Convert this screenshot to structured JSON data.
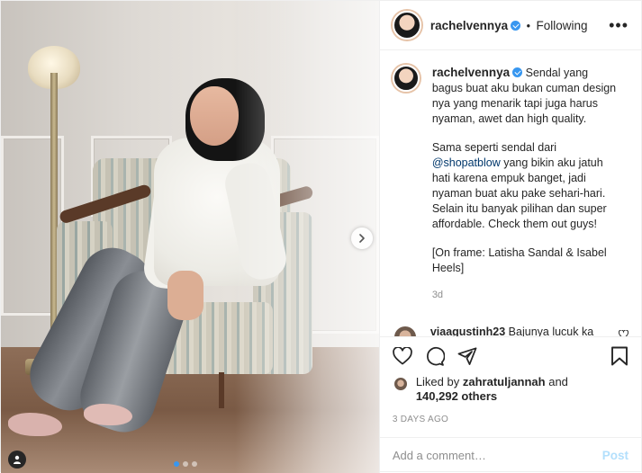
{
  "header": {
    "username": "rachelvennya",
    "separator": "•",
    "follow_status": "Following",
    "more_icon": "•••"
  },
  "caption": {
    "username": "rachelvennya",
    "paragraph1": "Sendal yang bagus buat aku bukan cuman design nya yang menarik tapi juga harus nyaman, awet dan high quality.",
    "paragraph2_prefix": "Sama seperti sendal dari ",
    "paragraph2_mention": "@shopatblow",
    "paragraph2_suffix": " yang bikin aku jatuh hati karena empuk banget, jadi nyaman buat aku pake sehari-hari. Selain itu banyak pilihan dan super affordable. Check them out guys!",
    "paragraph3": "[On frame: Latisha Sandal & Isabel Heels]",
    "time": "3d"
  },
  "comments": [
    {
      "username": "viaagustinh23",
      "text": "Bajunya lucuk ka chel"
    }
  ],
  "likes": {
    "prefix": "Liked by ",
    "liked_by_user": "zahratuljannah",
    "middle": " and",
    "count": "140,292 others"
  },
  "post_date": "3 DAYS AGO",
  "add_comment": {
    "placeholder": "Add a comment…",
    "post_label": "Post"
  },
  "carousel": {
    "total": 3,
    "active_index": 0
  },
  "colors": {
    "verified": "#3897f0",
    "mention": "#00376b",
    "post_disabled": "#b2dffc",
    "muted": "#8e8e8e"
  }
}
